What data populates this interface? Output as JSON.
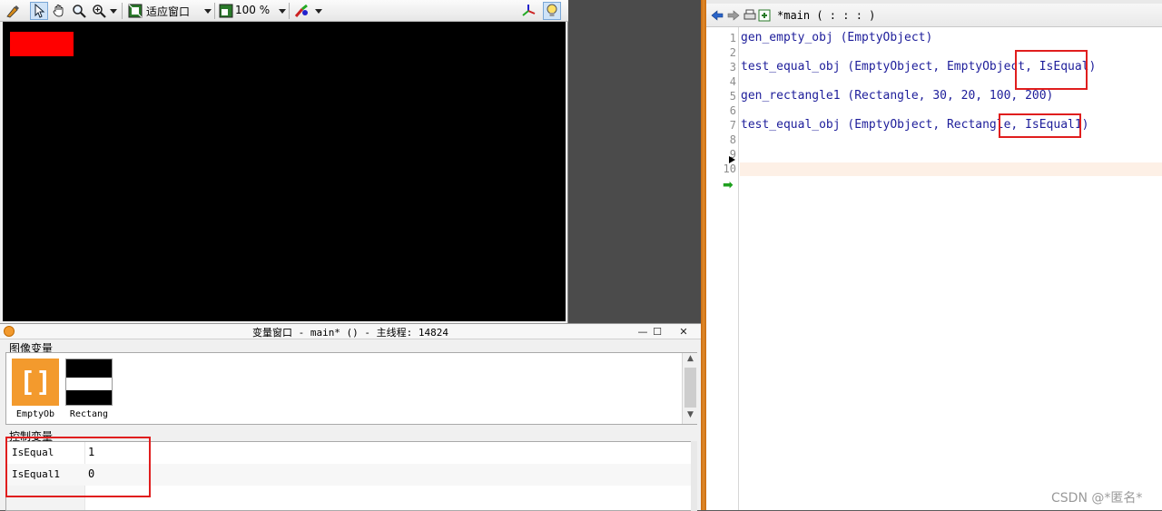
{
  "graphics_toolbar": {
    "icons": [
      "brush-icon",
      "pointer-icon",
      "hand-icon",
      "magnifier-icon",
      "zoom-icon",
      "fit-window-icon",
      "zoom-percent-icon",
      "color-tools-icon",
      "axes-icon",
      "lightbulb-icon"
    ],
    "fit_label": "适应窗口",
    "zoom_label": "100 %"
  },
  "graphics_window": {
    "canvas_color": "#000000",
    "region_color": "#ff0000"
  },
  "variable_window": {
    "title": "变量窗口 - main* () - 主线程: 14824",
    "image_section_label": "图像变量",
    "image_vars": [
      {
        "label": "EmptyOb",
        "icon": "empty-object-icon"
      },
      {
        "label": "Rectang",
        "icon": "rectangle-image-icon"
      }
    ],
    "control_section_label": "控制变量",
    "control_vars": [
      {
        "name": "IsEqual",
        "value": "1"
      },
      {
        "name": "IsEqual1",
        "value": "0"
      }
    ],
    "window_controls": [
      "—",
      "☐",
      "✕"
    ]
  },
  "editor": {
    "tab_label": "*main ( : : : )",
    "lines": [
      {
        "num": "1",
        "code": "gen_empty_obj (EmptyObject)"
      },
      {
        "num": "2",
        "code": ""
      },
      {
        "num": "3",
        "code": "test_equal_obj (EmptyObject, EmptyObject, IsEqual)"
      },
      {
        "num": "4",
        "code": ""
      },
      {
        "num": "5",
        "code": "gen_rectangle1 (Rectangle, 30, 20, 100, 200)"
      },
      {
        "num": "6",
        "code": ""
      },
      {
        "num": "7",
        "code": "test_equal_obj (EmptyObject, Rectangle, IsEqual1)"
      },
      {
        "num": "8",
        "code": ""
      },
      {
        "num": "9",
        "code": ""
      },
      {
        "num": "10",
        "code": ""
      }
    ]
  },
  "watermark": "CSDN @*匿名*",
  "colors": {
    "highlight_box": "#e01e1e",
    "code_text": "#1d1d9a",
    "empty_obj_icon": "#f39a2d"
  }
}
